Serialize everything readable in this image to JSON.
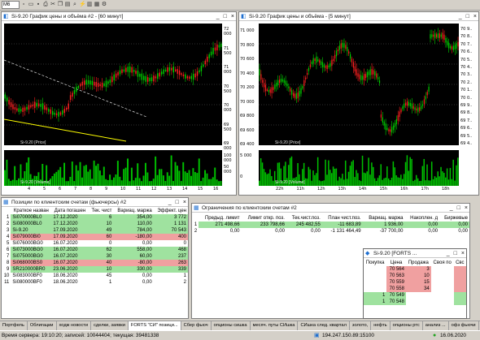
{
  "toolbar": {
    "instrument_select": "M6",
    "icons": [
      "new-window-icon",
      "open-icon",
      "save-icon",
      "print-icon",
      "cut-icon",
      "copy-icon",
      "paste-icon",
      "zoom-icon",
      "connect-icon",
      "chart-icon",
      "table-icon",
      "settings-icon"
    ]
  },
  "chart1": {
    "title": "Si-9.20 График цены и объёма #2 - [60 минут]",
    "price_label": "Si-9.20 [Price]",
    "volume_label": "Si-9.20 [Volume]",
    "price_ticks": [
      "72 000",
      "71 500",
      "71 000",
      "70 500",
      "70 000",
      "69 500",
      "69 000"
    ],
    "volume_ticks": [
      "100 000",
      "50 000"
    ],
    "x_ticks": [
      "4",
      "5",
      "6",
      "7",
      "8",
      "9",
      "10",
      "11",
      "12",
      "13",
      "14",
      "15",
      "16"
    ]
  },
  "chart2": {
    "title": "Si-9.20 График цены и объёма - [5 минут]",
    "price_label": "Si-9.20 [Price]",
    "volume_label": "Si-9.20 [Volume]",
    "price_ticks": [
      "71 000",
      "70 800",
      "70 600",
      "70 400",
      "70 200",
      "70 000",
      "69 800",
      "69 600",
      "69 400"
    ],
    "right_ticks": [
      "70 9..",
      "70 8..",
      "70 7..",
      "70 6..",
      "70 5..",
      "70 4..",
      "70 3..",
      "70 2..",
      "70 1..",
      "70 0..",
      "69 9..",
      "69 8..",
      "69 7..",
      "69 6..",
      "69 5..",
      "69 4.."
    ],
    "volume_ticks": [
      "5 000",
      "0"
    ],
    "x_ticks": [
      "22h",
      "11h",
      "12h",
      "13h",
      "14h",
      "15h",
      "16h",
      "17h",
      "18h"
    ]
  },
  "positions": {
    "title": "Позиции по клиентским счетам (фьючерсы) #2",
    "columns": [
      "",
      "Краткое назван",
      "Дата погашен",
      "Тек. чист",
      "Вариац. маржа",
      "Эффект. цен"
    ],
    "rows": [
      [
        "1",
        "Si070000BL0",
        "17.12.2020",
        "6",
        "354,00",
        "3 772"
      ],
      [
        "2",
        "Si080000BL0",
        "17.12.2020",
        "10",
        "110,00",
        "1 131"
      ],
      [
        "3",
        "Si-9.20",
        "17.09.2020",
        "49",
        "784,00",
        "70 543"
      ],
      [
        "4",
        "Si079000BI0",
        "17.09.2020",
        "60",
        "-180,00",
        "400"
      ],
      [
        "5",
        "Si076000BG0",
        "16.07.2020",
        "0",
        "0,00",
        "0"
      ],
      [
        "6",
        "Si073000BG0",
        "16.07.2020",
        "62",
        "558,00",
        "468"
      ],
      [
        "7",
        "Si075000BG0",
        "16.07.2020",
        "30",
        "60,00",
        "237"
      ],
      [
        "8",
        "Si068000BS0",
        "16.07.2020",
        "40",
        "-80,00",
        "263"
      ],
      [
        "9",
        "SR210000BR0",
        "23.06.2020",
        "10",
        "330,00",
        "339"
      ],
      [
        "10",
        "Si083000BF0",
        "18.06.2020",
        "45",
        "0,00",
        "1"
      ],
      [
        "11",
        "Si080000BF0",
        "18.06.2020",
        "1",
        "0,00",
        "2"
      ]
    ],
    "row_colors": [
      "green",
      "green",
      "green",
      "red",
      "white",
      "green",
      "green",
      "red",
      "green",
      "white",
      "white"
    ]
  },
  "limits": {
    "title": "Ограничения по клиентским счетам #2",
    "columns": [
      "",
      "Предыд. лимит",
      "Лимит откр. поз.",
      "Тек.чист.поз.",
      "План чист.поз.",
      "Вариац. маржа",
      "Накоплен. д",
      "Биржевые"
    ],
    "rows": [
      [
        "1",
        "271 498,66",
        "233 798,66",
        "245 482,55",
        "-11 683,89",
        "1 936,00",
        "0,00",
        "0,00"
      ],
      [
        "2",
        "0,00",
        "0,00",
        "0,00",
        "-1 131 464,49",
        "-37 700,00",
        "0,00",
        "0,00"
      ]
    ]
  },
  "orderbook": {
    "title": "Si-9.20 [FORTS ...",
    "columns": [
      "Покупка",
      "Цена",
      "Продажа",
      "Своя по",
      "Свс"
    ],
    "rows": [
      [
        "",
        "70 564",
        "3",
        "",
        ""
      ],
      [
        "",
        "70 563",
        "10",
        "",
        ""
      ],
      [
        "",
        "70 559",
        "15",
        "",
        ""
      ],
      [
        "",
        "70 558",
        "34",
        "",
        ""
      ],
      [
        "1",
        "70 549",
        "",
        "",
        ""
      ],
      [
        "1",
        "70 548",
        "",
        "",
        ""
      ],
      [
        "",
        "",
        "",
        "",
        ""
      ],
      [
        "",
        "",
        "",
        "",
        ""
      ]
    ]
  },
  "tabs": [
    "Портфель",
    "Облигации",
    "ходж новости",
    "сделки, заявки",
    "FORTS \"СИ\" позици...",
    "Сбер фьюч",
    "опционы сишка",
    "месяч. путы СИшка",
    "СИшка след. квартал",
    "золото,",
    "нефть",
    "опционы ртс",
    "анализ ...",
    "офз фьючи"
  ],
  "active_tab_index": 4,
  "status": {
    "left": "Время сервера: 19:10:20; записей: 10044404; текущая: 39481338",
    "server": "194.247.150.89:15100",
    "date": "16.06.2020"
  },
  "colors": {
    "chart_bg": "#000000",
    "candle_up": "#00d000",
    "candle_down": "#ff2020",
    "volume": "#00c000",
    "green_row": "#9fe29f",
    "red_row": "#f0a0a0"
  }
}
